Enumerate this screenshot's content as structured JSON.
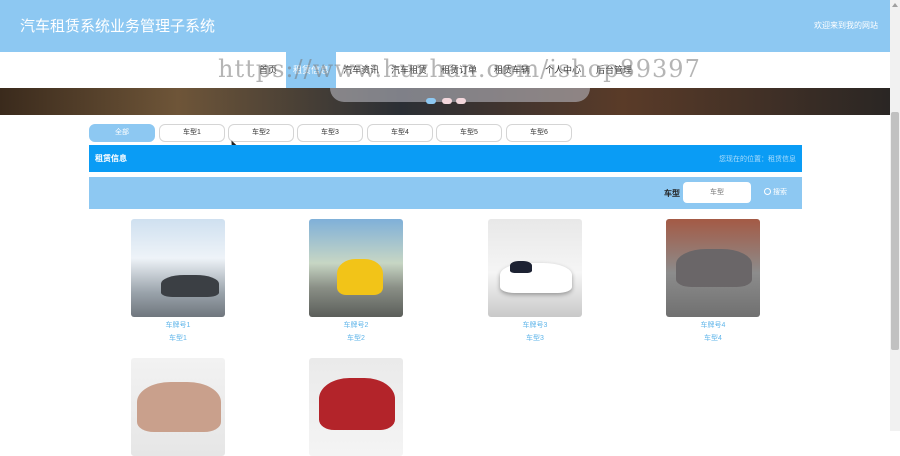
{
  "header": {
    "title": "汽车租赁系统业务管理子系统",
    "welcome": "欢迎来到我的网站"
  },
  "nav": [
    "首页",
    "租赁信息",
    "汽车资讯",
    "汽车租赁",
    "租赁订单",
    "租赁车辆",
    "个人中心",
    "后台管理"
  ],
  "watermark": "https://www.huzhan.com/ishop89397",
  "tabs": [
    "全部",
    "车型1",
    "车型2",
    "车型3",
    "车型4",
    "车型5",
    "车型6"
  ],
  "section": {
    "title": "租赁信息",
    "breadcrumb": "您现在的位置：租赁信息"
  },
  "filter": {
    "label": "车型",
    "placeholder": "车型",
    "search_label": "搜索"
  },
  "cars": [
    {
      "name": "车牌号1",
      "type": "车型1"
    },
    {
      "name": "车牌号2",
      "type": "车型2"
    },
    {
      "name": "车牌号3",
      "type": "车型3"
    },
    {
      "name": "车牌号4",
      "type": "车型4"
    },
    {
      "name": "",
      "type": ""
    },
    {
      "name": "",
      "type": ""
    }
  ],
  "icons": {
    "search": "search-icon"
  },
  "colors": {
    "header": "#8dc8f2",
    "section": "#0a9cf5",
    "link": "#5fb5ea"
  }
}
